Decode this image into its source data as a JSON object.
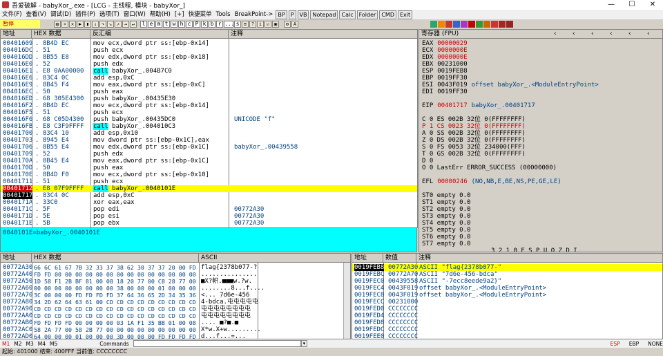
{
  "title": "吾爱破解 - babyXor_.exe - [LCG - 主线程, 模块 - babyXor_]",
  "menu": [
    "文件(F)",
    "查看(V)",
    "调试(D)",
    "插件(P)",
    "选项(T)",
    "窗口(W)",
    "帮助(H)",
    "[+]",
    "快捷菜单",
    "Tools",
    "BreakPoint->"
  ],
  "menu_buttons": [
    "BP",
    "P",
    "VB",
    "Notepad",
    "Calc",
    "Folder",
    "CMD",
    "Exit"
  ],
  "toolbar_status": "暂停",
  "toolbar_letters": [
    "l",
    "e",
    "m",
    "t",
    "w",
    "h",
    "c",
    "P",
    "k",
    "b",
    "r",
    "...",
    "s"
  ],
  "disasm_headers": {
    "addr": "地址",
    "hex": "HEX 数据",
    "asm": "反汇编",
    "cmt": "注释"
  },
  "disasm": [
    {
      "a": "00401609",
      "h": ". 8B4D EC",
      "i": "mov ecx,dword ptr ss:[ebp-0x14]",
      "c": "",
      "t": ""
    },
    {
      "a": "004016DC",
      "h": ". 51",
      "i": "push ecx",
      "c": "",
      "t": ""
    },
    {
      "a": "004016DD",
      "h": ". 8B55 E8",
      "i": "mov edx,dword ptr ss:[ebp-0x18]",
      "c": "",
      "t": ""
    },
    {
      "a": "004016E0",
      "h": ". 52",
      "i": "push edx",
      "c": "",
      "t": ""
    },
    {
      "a": "004016E1",
      "h": ". E8 0AA00000",
      "i": "call babyXor_.004B7C0",
      "c": "",
      "t": "call"
    },
    {
      "a": "004016E6",
      "h": ". 83C4 0C",
      "i": "add esp,0xC",
      "c": "",
      "t": ""
    },
    {
      "a": "004016E9",
      "h": ". 8B45 F4",
      "i": "mov eax,dword ptr ss:[ebp-0xC]",
      "c": "",
      "t": ""
    },
    {
      "a": "004016EC",
      "h": ". 50",
      "i": "push eax",
      "c": "",
      "t": ""
    },
    {
      "a": "004016ED",
      "h": ". 68 305E4300",
      "i": "push babyXor_.00435E30",
      "c": "",
      "t": ""
    },
    {
      "a": "004016F2",
      "h": ". 8B4D EC",
      "i": "mov ecx,dword ptr ss:[ebp-0x14]",
      "c": "",
      "t": ""
    },
    {
      "a": "004016F5",
      "h": ". 51",
      "i": "push ecx",
      "c": "",
      "t": ""
    },
    {
      "a": "004016F6",
      "h": ". 68 C05D4300",
      "i": "push babyXor_.00435DC0",
      "c": "UNICODE \"f\"",
      "t": ""
    },
    {
      "a": "004016FB",
      "h": ". E8 C3F9FFFF",
      "i": "call babyXor_.004010C3",
      "c": "",
      "t": "call"
    },
    {
      "a": "00401700",
      "h": ". 83C4 10",
      "i": "add esp,0x10",
      "c": "",
      "t": ""
    },
    {
      "a": "00401703",
      "h": ". 8945 E4",
      "i": "mov dword ptr ss:[ebp-0x1C],eax",
      "c": "",
      "t": ""
    },
    {
      "a": "00401706",
      "h": ". 8B55 E4",
      "i": "mov edx,dword ptr ss:[ebp-0x1C]",
      "c": "babyXor_.00439558",
      "t": ""
    },
    {
      "a": "00401709",
      "h": ". 52",
      "i": "push edx",
      "c": "",
      "t": ""
    },
    {
      "a": "0040170A",
      "h": ". 8B45 E4",
      "i": "mov eax,dword ptr ss:[ebp-0x1C]",
      "c": "",
      "t": ""
    },
    {
      "a": "0040170D",
      "h": ". 50",
      "i": "push eax",
      "c": "",
      "t": ""
    },
    {
      "a": "0040170E",
      "h": ". 8B4D F0",
      "i": "mov ecx,dword ptr ss:[ebp-0x10]",
      "c": "",
      "t": ""
    },
    {
      "a": "00401711",
      "h": ". 51",
      "i": "push ecx",
      "c": "",
      "t": ""
    },
    {
      "a": "00401712",
      "h": ". E8 07F9FFFF",
      "i": "call babyXor_.0040101E",
      "c": "",
      "t": "hlred"
    },
    {
      "a": "00401717",
      "h": ". 83C4 0C",
      "i": "add esp,0xC",
      "c": "",
      "t": "blk"
    },
    {
      "a": "0040171A",
      "h": ". 33C0",
      "i": "xor eax,eax",
      "c": "",
      "t": ""
    },
    {
      "a": "0040171C",
      "h": ". 5F",
      "i": "pop edi",
      "c": "00772A30",
      "t": ""
    },
    {
      "a": "0040171D",
      "h": ". 5E",
      "i": "pop esi",
      "c": "00772A30",
      "t": ""
    },
    {
      "a": "0040171E",
      "h": ". 5B",
      "i": "pop ebx",
      "c": "00772A30",
      "t": ""
    }
  ],
  "info_line": "0040101E=babyXor_.0040101E",
  "reg_header": "寄存器 (FPU)",
  "registers": [
    {
      "n": "EAX",
      "v": "00000029",
      "x": "",
      "red": true
    },
    {
      "n": "ECX",
      "v": "0000000E",
      "x": "",
      "red": true
    },
    {
      "n": "EDX",
      "v": "0000000E",
      "x": "",
      "red": true
    },
    {
      "n": "EBX",
      "v": "00231000",
      "x": "",
      "red": false
    },
    {
      "n": "ESP",
      "v": "0019FEB8",
      "x": "",
      "red": false
    },
    {
      "n": "EBP",
      "v": "0019FF30",
      "x": "",
      "red": false
    },
    {
      "n": "ESI",
      "v": "0043F019",
      "x": "offset babyXor_.<ModuleEntryPoint>",
      "red": false
    },
    {
      "n": "EDI",
      "v": "0019FF30",
      "x": "",
      "red": false
    }
  ],
  "eip": {
    "n": "EIP",
    "v": "00401717",
    "x": "babyXor_.00401717"
  },
  "flags": [
    "C 0  ES 002B 32位 0(FFFFFFFF)",
    "P 1  CS 0023 32位 0(FFFFFFFF)",
    "A 0  SS 002B 32位 0(FFFFFFFF)",
    "Z 0  DS 002B 32位 0(FFFFFFFF)",
    "S 0  FS 0053 32位 234000(FFF)",
    "T 0  GS 002B 32位 0(FFFFFFFF)",
    "D 0",
    "O 0  LastErr ERROR_SUCCESS (00000000)"
  ],
  "efl": {
    "n": "EFL",
    "v": "00000246",
    "x": "(NO,NB,E,BE,NS,PE,GE,LE)"
  },
  "fpu": [
    "ST0 empty 0.0",
    "ST1 empty 0.0",
    "ST2 empty 0.0",
    "ST3 empty 0.0",
    "ST4 empty 0.0",
    "ST5 empty 0.0",
    "ST6 empty 0.0",
    "ST7 empty 0.0"
  ],
  "fpu_bits": "3 2 1 0       E S P U O Z D I",
  "fst": "FST 0000  Cond 0 0 0 0  Err 0 0 0 0 0 0 0 0  (GT)",
  "fcw": "FCW 027F  Prec NEAR,53  掩码    1 1 1 1 1 1",
  "dump_headers": {
    "addr": "地址",
    "hex": "HEX 数据",
    "ascii": "ASCII"
  },
  "dump": [
    {
      "a": "00772A30",
      "h": "66 6C 61 67 7B 32 33 37 38 62 30 37 37 20 00 FD",
      "s": "flag{2378b077-?"
    },
    {
      "a": "00772A40",
      "h": "FD FD 00 00 00 00 00 00 00 00 00 00 00 00 00 00",
      "s": "  ..............."
    },
    {
      "a": "00772A50",
      "h": "1D 58 F1 2B BF 81 00 08 18 20 77 00 C8 28 77 00",
      "s": "■X?帜.■■■w.?w."
    },
    {
      "a": "00772A60",
      "h": "00 00 00 00 00 00 00 00 38 00 00 00 01 00 00 00",
      "s": "........8...f...."
    },
    {
      "a": "00772A70",
      "h": "3C 00 00 00 FD FD FD FD 37 64 36 65 2D 34 35 36",
      "s": "<...    7d6e-456"
    },
    {
      "a": "00772A80",
      "h": "34 2D 62 64 63 61 00 CD CD CD CD CD CD CD CD CD",
      "s": "4-bdca.屯屯屯屯屯"
    },
    {
      "a": "00772A90",
      "h": "CD CD CD CD CD CD CD CD CD CD CD CD CD CD CD CD",
      "s": "屯屯屯屯屯屯屯屯"
    },
    {
      "a": "00772AA0",
      "h": "CD CD CD CD CD CD CD CD CD CD CD CD CD CD CD CD",
      "s": "屯屯屯屯屯屯屯屯"
    },
    {
      "a": "00772AB0",
      "h": "FD FD FD FD 00 00 00 00 03 1A F1 35 BB 01 00 08",
      "s": "    .... ■?■.■"
    },
    {
      "a": "00772AC0",
      "h": "58 2A 77 00 58 2B 77 00 00 00 00 00 00 00 00 00",
      "s": "X*w.X+w........."
    },
    {
      "a": "00772AD0",
      "h": "64 00 00 00 01 00 00 00 3D 00 00 00 FD FD FD FD",
      "s": "d...f...=...    "
    }
  ],
  "stack_headers": {
    "addr": "地址",
    "val": "数值",
    "cmt": "注释"
  },
  "stack": [
    {
      "a": "0019FEB8",
      "v": "00772A30",
      "c": "ASCII \"flag{2378b077-\"",
      "hl": true
    },
    {
      "a": "0019FEBC",
      "v": "00772A70",
      "c": "ASCII \"7d6e-456-bdca\"",
      "hl": false
    },
    {
      "a": "0019FEC0",
      "v": "00439558",
      "c": "ASCII \"-7ecc8eede9a2}\"",
      "hl": false
    },
    {
      "a": "0019FEC4",
      "v": "0043F019",
      "c": "offset babyXor_.<ModuleEntryPoint>",
      "hl": false
    },
    {
      "a": "0019FEC8",
      "v": "0043F019",
      "c": "offset babyXor_.<ModuleEntryPoint>",
      "hl": false
    },
    {
      "a": "0019FECC",
      "v": "00231000",
      "c": "",
      "hl": false
    },
    {
      "a": "0019FED0",
      "v": "CCCCCCCC",
      "c": "",
      "hl": false
    },
    {
      "a": "0019FED4",
      "v": "CCCCCCCC",
      "c": "",
      "hl": false
    },
    {
      "a": "0019FED8",
      "v": "CCCCCCCC",
      "c": "",
      "hl": false
    },
    {
      "a": "0019FEDC",
      "v": "CCCCCCCC",
      "c": "",
      "hl": false
    },
    {
      "a": "0019FEE0",
      "v": "CCCCCCCC",
      "c": "",
      "hl": false
    }
  ],
  "cmd_tabs": [
    "M1",
    "M2",
    "M3",
    "M4",
    "M5"
  ],
  "cmd_label": "Commands",
  "cmd_right": [
    "ESP",
    "EBP",
    "NONE"
  ],
  "status_line": "起始: 401000  结束: 400FFF  当前值: CCCCCCCC"
}
